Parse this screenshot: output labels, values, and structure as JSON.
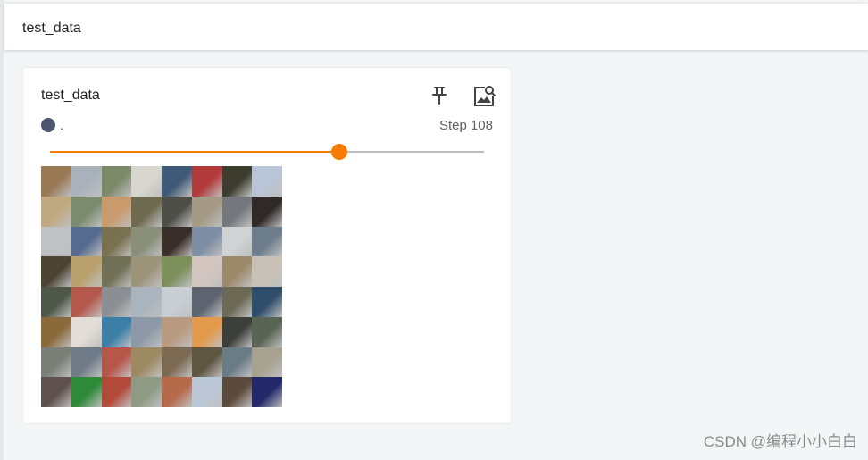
{
  "header": {
    "title": "test_data"
  },
  "card": {
    "title": "test_data",
    "run_name": ".",
    "run_color": "#4a5670",
    "step_text": "Step 108",
    "slider_fraction": 0.667,
    "accent_color": "#f57c00",
    "actions": [
      {
        "name": "pin-icon"
      },
      {
        "name": "image-search-icon"
      }
    ]
  },
  "image_grid": {
    "rows": 8,
    "cols": 8,
    "tile_colors": [
      "#9a7a55",
      "#a9b2bb",
      "#7d8a6a",
      "#d8d6cf",
      "#3f5a78",
      "#b33a3a",
      "#3c3d2e",
      "#b9c5d6",
      "#c0a980",
      "#7b8b6e",
      "#c99b6c",
      "#6e6a4f",
      "#4f4f4a",
      "#a49a86",
      "#74777c",
      "#2f2a28",
      "#bfc2c4",
      "#556b8f",
      "#7a7150",
      "#8a8f7a",
      "#3a2e2a",
      "#7e8ea5",
      "#cfd3d4",
      "#6d7d8c",
      "#4d4333",
      "#b9a06c",
      "#6f7055",
      "#9c9479",
      "#7d8f5a",
      "#d3c6c0",
      "#9d8a6a",
      "#c8c1b6",
      "#4f5848",
      "#b5584c",
      "#8b8f93",
      "#aab4be",
      "#c9ced5",
      "#5d6470",
      "#6c6a55",
      "#2f4e6b",
      "#8a6a3a",
      "#e2ddd6",
      "#3b7fa8",
      "#8d99a7",
      "#b89a80",
      "#e39a4c",
      "#3c3f3a",
      "#5a6454",
      "#7a7f78",
      "#6f7a88",
      "#b6574a",
      "#9d8a62",
      "#7c6b52",
      "#5e5640",
      "#6a7c86",
      "#a6a28f",
      "#5f514d",
      "#2f8a3a",
      "#b24a3a",
      "#8e9a84",
      "#b56a4a",
      "#bcc8d8",
      "#5c4a3c",
      "#22286a"
    ]
  },
  "watermark": "CSDN @编程小小白白"
}
